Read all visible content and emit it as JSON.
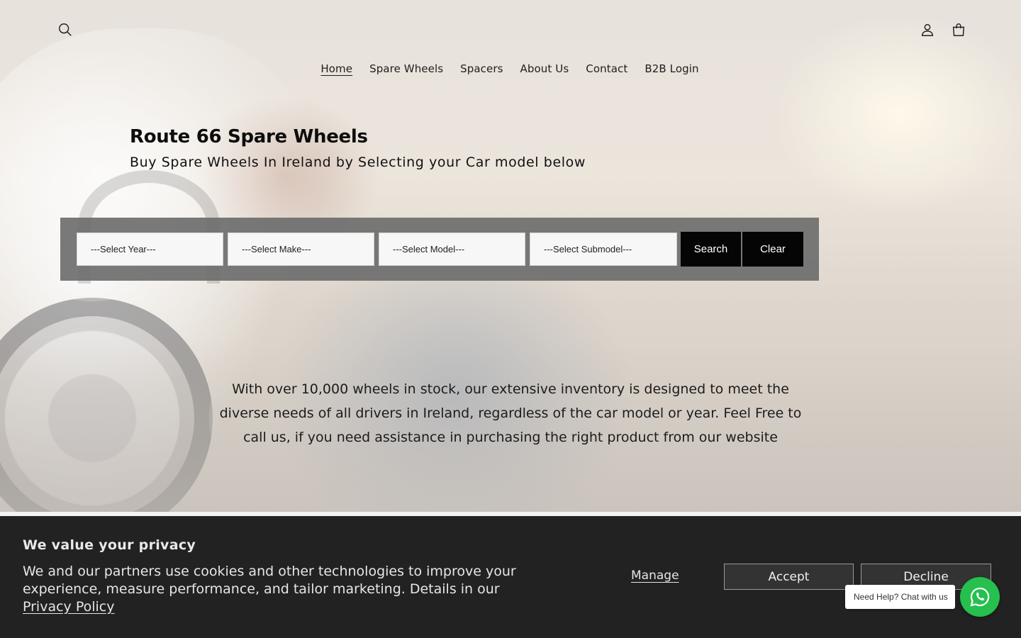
{
  "colors": {
    "panel": "#6e6e6e",
    "button_dark": "#050505",
    "cookie_bg": "#222222",
    "whatsapp": "#25c04e"
  },
  "header": {
    "icons": [
      "search-icon",
      "account-icon",
      "cart-icon"
    ],
    "nav": [
      {
        "label": "Home",
        "active": true
      },
      {
        "label": "Spare Wheels",
        "active": false
      },
      {
        "label": "Spacers",
        "active": false
      },
      {
        "label": "About Us",
        "active": false
      },
      {
        "label": "Contact",
        "active": false
      },
      {
        "label": "B2B Login",
        "active": false
      }
    ]
  },
  "hero": {
    "title": "Route 66 Spare Wheels",
    "subtitle": "Buy Spare Wheels In Ireland by Selecting your Car model below",
    "description": "With over 10,000 wheels in stock, our extensive inventory is designed to meet the diverse needs of all drivers in Ireland, regardless of the car model or year. Feel Free to call us, if you need assistance in purchasing the right product from our website"
  },
  "filter": {
    "year": "---Select Year---",
    "make": "---Select Make---",
    "model": "---Select Model---",
    "submodel": "---Select Submodel---",
    "search_label": "Search",
    "clear_label": "Clear"
  },
  "cookie": {
    "title": "We value your privacy",
    "text": "We and our partners use cookies and other technologies to improve your experience, measure performance, and tailor marketing. Details in our",
    "policy_link": "Privacy Policy",
    "manage_label": "Manage",
    "accept_label": "Accept",
    "decline_label": "Decline"
  },
  "chat": {
    "label": "Need Help? Chat with us",
    "icon": "whatsapp-icon"
  }
}
